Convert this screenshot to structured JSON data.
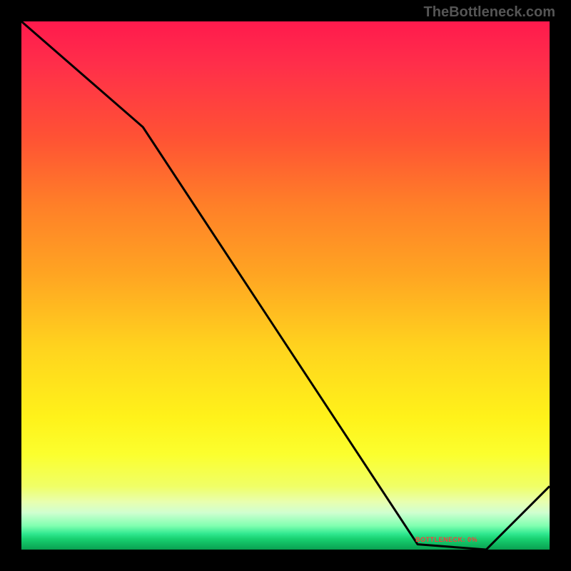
{
  "watermark": "TheBottleneck.com",
  "label_text": "BOTTLENECK: 0%",
  "chart_data": {
    "type": "line",
    "title": "",
    "xlabel": "",
    "ylabel": "",
    "xlim": [
      0,
      100
    ],
    "ylim": [
      0,
      100
    ],
    "series": [
      {
        "name": "bottleneck-curve",
        "x": [
          0,
          23,
          75,
          88,
          100
        ],
        "values": [
          100,
          80,
          1,
          0,
          12
        ]
      }
    ],
    "gradient_stops": [
      {
        "pos": 0,
        "color": "#ff1a4d"
      },
      {
        "pos": 0.22,
        "color": "#ff5234"
      },
      {
        "pos": 0.48,
        "color": "#ffa522"
      },
      {
        "pos": 0.75,
        "color": "#fff21a"
      },
      {
        "pos": 0.97,
        "color": "#30e890"
      },
      {
        "pos": 1.0,
        "color": "#0aa050"
      }
    ],
    "label": {
      "text": "BOTTLENECK: 0%",
      "x": 80,
      "y": 1
    }
  }
}
